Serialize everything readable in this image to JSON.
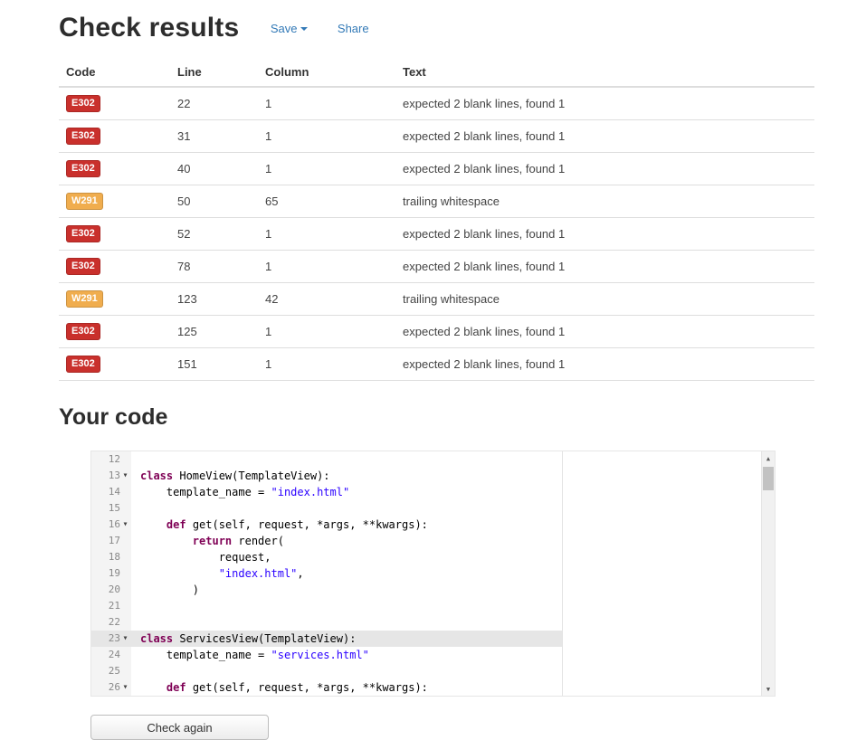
{
  "page": {
    "title": "Check results",
    "save_label": "Save",
    "share_label": "Share",
    "your_code_title": "Your code",
    "check_again_label": "Check again"
  },
  "icons": {
    "caret_down": "▾",
    "scroll_up_arrow": "▲",
    "scroll_down_arrow": "▼",
    "fold_marker": "▾"
  },
  "colors": {
    "error_badge": "#c9302c",
    "warning_badge": "#f0ad4e",
    "link": "#337ab7"
  },
  "results_table": {
    "headers": [
      "Code",
      "Line",
      "Column",
      "Text"
    ],
    "rows": [
      {
        "code": "E302",
        "type": "error",
        "line": "22",
        "column": "1",
        "text": "expected 2 blank lines, found 1"
      },
      {
        "code": "E302",
        "type": "error",
        "line": "31",
        "column": "1",
        "text": "expected 2 blank lines, found 1"
      },
      {
        "code": "E302",
        "type": "error",
        "line": "40",
        "column": "1",
        "text": "expected 2 blank lines, found 1"
      },
      {
        "code": "W291",
        "type": "warning",
        "line": "50",
        "column": "65",
        "text": "trailing whitespace"
      },
      {
        "code": "E302",
        "type": "error",
        "line": "52",
        "column": "1",
        "text": "expected 2 blank lines, found 1"
      },
      {
        "code": "E302",
        "type": "error",
        "line": "78",
        "column": "1",
        "text": "expected 2 blank lines, found 1"
      },
      {
        "code": "W291",
        "type": "warning",
        "line": "123",
        "column": "42",
        "text": "trailing whitespace"
      },
      {
        "code": "E302",
        "type": "error",
        "line": "125",
        "column": "1",
        "text": "expected 2 blank lines, found 1"
      },
      {
        "code": "E302",
        "type": "error",
        "line": "151",
        "column": "1",
        "text": "expected 2 blank lines, found 1"
      }
    ]
  },
  "editor": {
    "first_line": 12,
    "active_line": 23,
    "lines": [
      {
        "n": 12,
        "fold": false,
        "seg": []
      },
      {
        "n": 13,
        "fold": true,
        "seg": [
          [
            "kw",
            "class"
          ],
          [
            "pl",
            " HomeView(TemplateView):"
          ]
        ]
      },
      {
        "n": 14,
        "fold": false,
        "seg": [
          [
            "pl",
            "    template_name = "
          ],
          [
            "str",
            "\"index.html\""
          ]
        ]
      },
      {
        "n": 15,
        "fold": false,
        "seg": []
      },
      {
        "n": 16,
        "fold": true,
        "seg": [
          [
            "pl",
            "    "
          ],
          [
            "kw",
            "def"
          ],
          [
            "pl",
            " get(self, request, *args, **kwargs):"
          ]
        ]
      },
      {
        "n": 17,
        "fold": false,
        "seg": [
          [
            "pl",
            "        "
          ],
          [
            "kw",
            "return"
          ],
          [
            "pl",
            " render("
          ]
        ]
      },
      {
        "n": 18,
        "fold": false,
        "seg": [
          [
            "pl",
            "            request,"
          ]
        ]
      },
      {
        "n": 19,
        "fold": false,
        "seg": [
          [
            "pl",
            "            "
          ],
          [
            "str",
            "\"index.html\""
          ],
          [
            "pl",
            ","
          ]
        ]
      },
      {
        "n": 20,
        "fold": false,
        "seg": [
          [
            "pl",
            "        )"
          ]
        ]
      },
      {
        "n": 21,
        "fold": false,
        "seg": []
      },
      {
        "n": 22,
        "fold": false,
        "seg": []
      },
      {
        "n": 23,
        "fold": true,
        "seg": [
          [
            "kw",
            "class"
          ],
          [
            "pl",
            " ServicesView(TemplateView):"
          ]
        ]
      },
      {
        "n": 24,
        "fold": false,
        "seg": [
          [
            "pl",
            "    template_name = "
          ],
          [
            "str",
            "\"services.html\""
          ]
        ]
      },
      {
        "n": 25,
        "fold": false,
        "seg": []
      },
      {
        "n": 26,
        "fold": true,
        "seg": [
          [
            "pl",
            "    "
          ],
          [
            "kw",
            "def"
          ],
          [
            "pl",
            " get(self, request, *args, **kwargs):"
          ]
        ]
      }
    ]
  }
}
